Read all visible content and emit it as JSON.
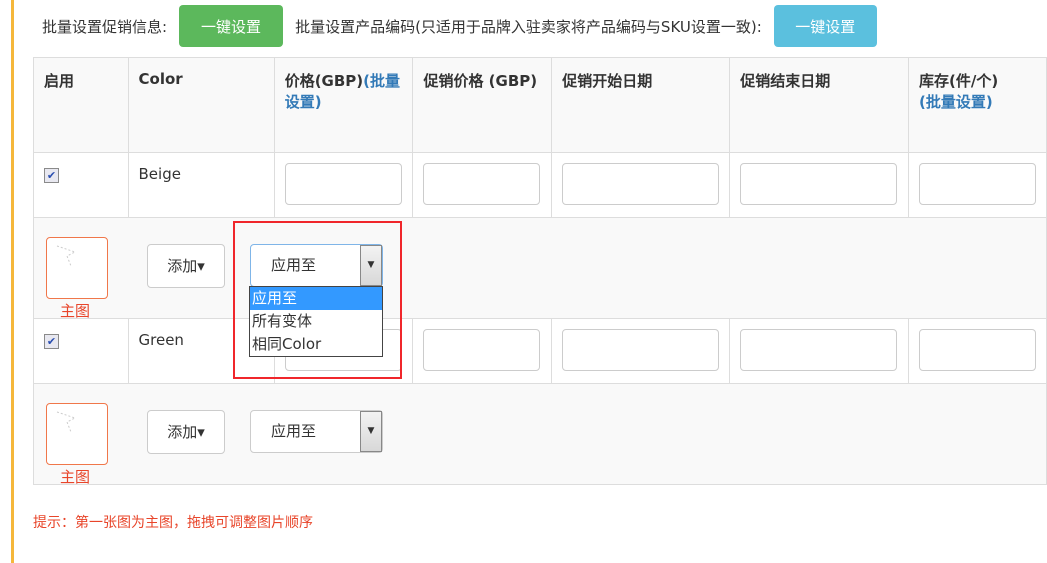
{
  "topbar": {
    "promo_label": "批量设置促销信息:",
    "promo_button": "一键设置",
    "code_label": "批量设置产品编码(只适用于品牌入驻卖家将产品编码与SKU设置一致):",
    "code_button": "一键设置"
  },
  "table": {
    "headers": {
      "enable": "启用",
      "color": "Color",
      "price": "价格(GBP)",
      "price_batch": "(批量设置)",
      "promo_price": "促销价格 (GBP)",
      "promo_start": "促销开始日期",
      "promo_end": "促销结束日期",
      "stock": "库存(件/个)",
      "stock_batch": "(批量设置)"
    },
    "rows": [
      {
        "enabled": true,
        "color": "Beige",
        "image_label": "主图",
        "add_label": "添加▾",
        "apply_value": "应用至"
      },
      {
        "enabled": true,
        "color": "Green",
        "image_label": "主图",
        "add_label": "添加▾",
        "apply_value": "应用至"
      }
    ]
  },
  "dropdown": {
    "options": [
      "应用至",
      "所有变体",
      "相同Color"
    ],
    "selected": "应用至"
  },
  "hint": "提示：第一张图为主图，拖拽可调整图片顺序"
}
